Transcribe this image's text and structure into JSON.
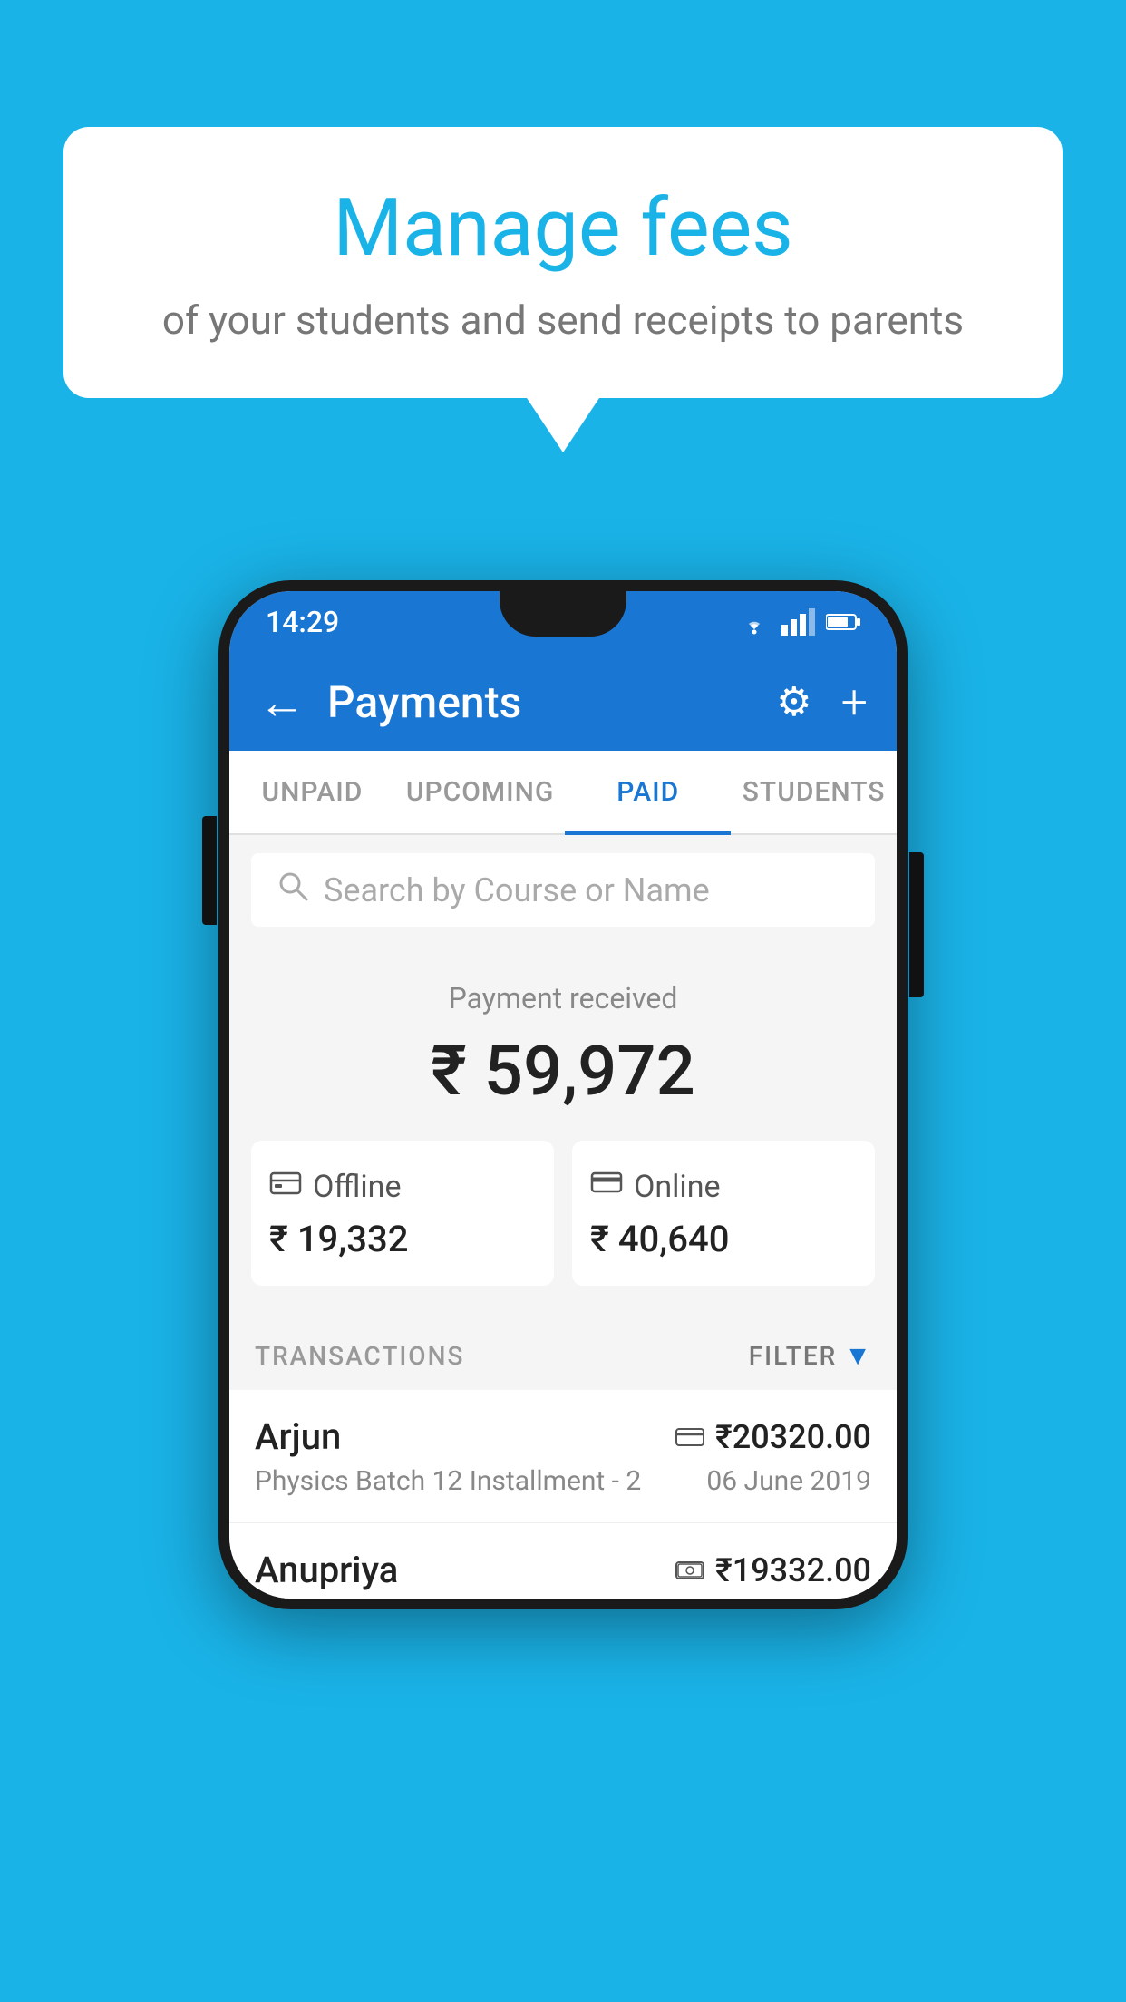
{
  "background_color": "#1ab3e8",
  "hero": {
    "title": "Manage fees",
    "subtitle": "of your students and send receipts to parents"
  },
  "status_bar": {
    "time": "14:29",
    "wifi": "▾",
    "signal": "▲",
    "battery": "▮"
  },
  "app_bar": {
    "title": "Payments",
    "back_label": "←",
    "settings_label": "⚙",
    "add_label": "+"
  },
  "tabs": [
    {
      "label": "UNPAID",
      "active": false
    },
    {
      "label": "UPCOMING",
      "active": false
    },
    {
      "label": "PAID",
      "active": true
    },
    {
      "label": "STUDENTS",
      "active": false
    }
  ],
  "search": {
    "placeholder": "Search by Course or Name"
  },
  "payment_summary": {
    "received_label": "Payment received",
    "total_amount": "₹ 59,972",
    "offline": {
      "label": "Offline",
      "amount": "₹ 19,332"
    },
    "online": {
      "label": "Online",
      "amount": "₹ 40,640"
    }
  },
  "transactions": {
    "header_label": "TRANSACTIONS",
    "filter_label": "FILTER",
    "items": [
      {
        "name": "Arjun",
        "course": "Physics Batch 12 Installment - 2",
        "date": "06 June 2019",
        "amount": "₹20320.00",
        "payment_type": "card"
      },
      {
        "name": "Anupriya",
        "course": "",
        "date": "",
        "amount": "₹19332.00",
        "payment_type": "cash"
      }
    ]
  }
}
